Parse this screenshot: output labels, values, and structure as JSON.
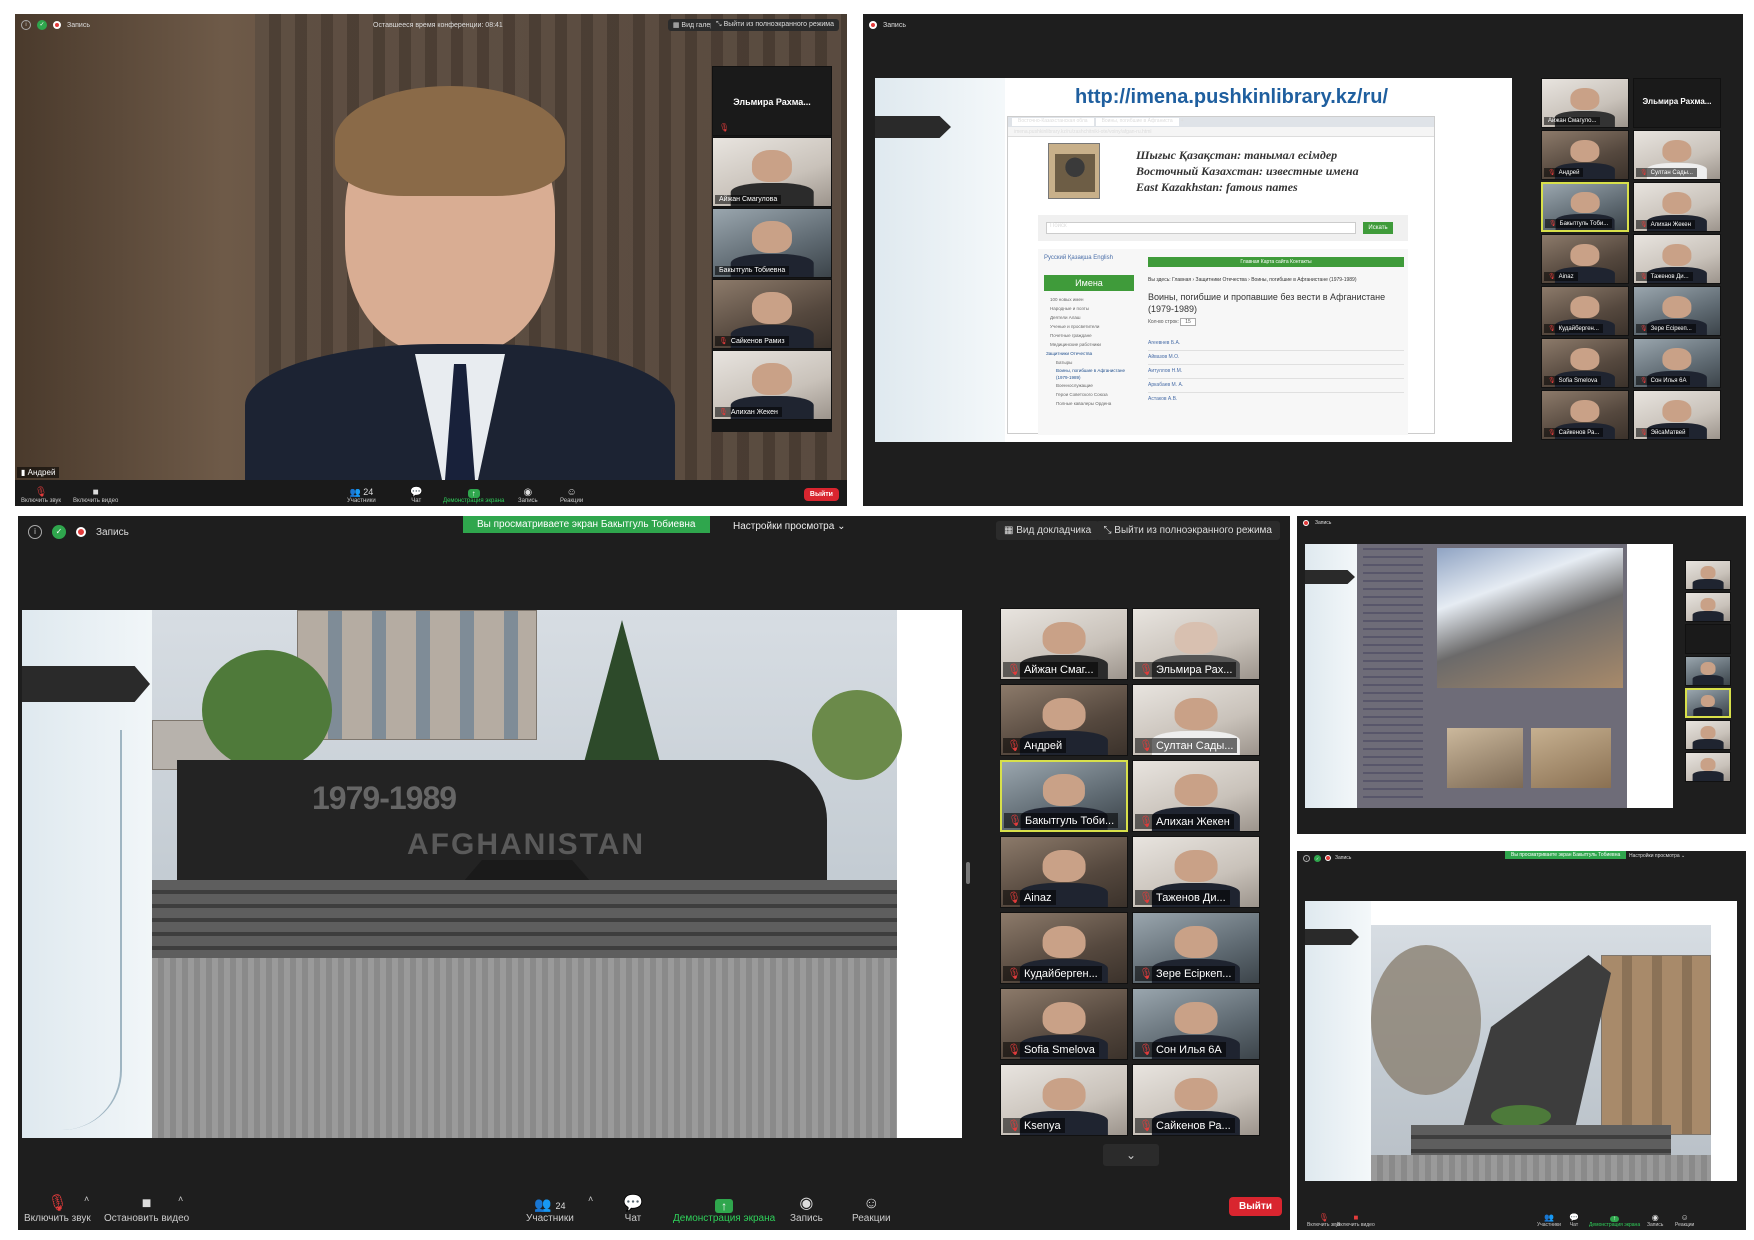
{
  "p1": {
    "topbar": {
      "record": "Запись",
      "timer": "Оставшееся время конференции: 08:41",
      "gallery": "Вид галереи",
      "exit_fullscreen": "Выйти из полноэкранного режима"
    },
    "speaker": "Андрей",
    "participants": [
      {
        "name": "Эльмира Рахма..."
      },
      {
        "name": "Айжан Смагулова"
      },
      {
        "name": "Бакытгуль Тобиевна"
      },
      {
        "name": "Сайкенов Рамиз"
      },
      {
        "name": "Алихан Жекен"
      }
    ],
    "toolbar": {
      "mute": "Включить звук",
      "video": "Включить видео",
      "participants": "Участники",
      "count": "24",
      "chat": "Чат",
      "share": "Демонстрация экрана",
      "record": "Запись",
      "reactions": "Реакции",
      "leave": "Выйти"
    }
  },
  "p2": {
    "topbar": {
      "record": "Запись"
    },
    "slide": {
      "url_heading": "http://imena.pushkinlibrary.kz/ru/",
      "tabs": [
        "Восточно-Казахстанская обла",
        "Воины, погибшие в Афганиста"
      ],
      "address": "imena.pushkinlibrary.kz/ru/zashchitniki-ote/voiny/afgan-ru.html",
      "titles": [
        "Шығыс Қазақстан: танымал есімдер",
        "Восточный Казахстан: известные имена",
        "East Kazakhstan: famous names"
      ],
      "search_placeholder": "Поиск",
      "search_button": "Искать",
      "lang": "Русский  Қазақша  English",
      "nav": "Главная  Карта сайта  Контакты",
      "sidebar_title": "Имена",
      "sidebar": [
        "100 новых имен",
        "Народные и поэты",
        "Деятели Алаш",
        "Ученые и просветители",
        "Почетные граждане",
        "Медицинские работники",
        "Защитники Отечества",
        "Батыры",
        "Воины, погибшие в Афганистане (1979-1989)",
        "Военнослужащие",
        "Герои Советского Союза",
        "Полные кавалеры Ордена"
      ],
      "breadcrumb": "Вы здесь: Главная › Защитники Отечества › Воины, погибшие в Афганистане (1979-1989)",
      "page_title": "Воины, погибшие и пропавшие без вести в Афганистане (1979-1989)",
      "per_page_label": "Кол-во строк:",
      "per_page_value": "15",
      "names": [
        "Агеевнев Б.А.",
        "Айвазов М.О.",
        "Аитуллов Н.М.",
        "Аркабаев М. А.",
        "Астаков А.В."
      ]
    },
    "participants": [
      {
        "name": "Айжан Смагуло..."
      },
      {
        "name": "Эльмира Рахма..."
      },
      {
        "name": "Андрей"
      },
      {
        "name": "Султан Сады..."
      },
      {
        "name": "Бакытгуль Тоби..."
      },
      {
        "name": "Алихан Жекен"
      },
      {
        "name": "Ainaz"
      },
      {
        "name": "Таженов Ди..."
      },
      {
        "name": "Кудайберген..."
      },
      {
        "name": "Зере Есіркеп..."
      },
      {
        "name": "Sofia Smelova"
      },
      {
        "name": "Сон Илья 6А"
      },
      {
        "name": "Сайкенов Ра..."
      },
      {
        "name": "ЭйсаМатвей"
      }
    ]
  },
  "p3": {
    "topbar": {
      "record": "Запись",
      "viewing": "Вы просматриваете экран Бакытгуль Тобиевна",
      "view_settings": "Настройки просмотра",
      "speaker_view": "Вид докладчика",
      "exit_fullscreen": "Выйти из полноэкранного режима"
    },
    "participants": [
      {
        "name": "Айжан Смаг..."
      },
      {
        "name": "Эльмира Рах..."
      },
      {
        "name": "Андрей"
      },
      {
        "name": "Султан Сады..."
      },
      {
        "name": "Бакытгуль Тоби..."
      },
      {
        "name": "Алихан Жекен"
      },
      {
        "name": "Ainaz"
      },
      {
        "name": "Таженов Ди..."
      },
      {
        "name": "Кудайберген..."
      },
      {
        "name": "Зере Есіркеп..."
      },
      {
        "name": "Sofia Smelova"
      },
      {
        "name": "Сон Илья 6А"
      },
      {
        "name": "Ksenya"
      },
      {
        "name": "Сайкенов Ра..."
      }
    ],
    "memorial": {
      "years": "1979-1989",
      "word": "AFGHANISTAN"
    },
    "toolbar": {
      "mute": "Включить звук",
      "video": "Остановить видео",
      "participants": "Участники",
      "count": "24",
      "chat": "Чат",
      "share": "Демонстрация экрана",
      "record": "Запись",
      "reactions": "Реакции",
      "leave": "Выйти"
    }
  },
  "p4": {
    "topbar": {
      "record": "Запись"
    }
  },
  "p5": {
    "topbar": {
      "record": "Запись",
      "viewing": "Вы просматриваете экран Бакытгуль Тобиевна",
      "view_settings": "Настройки просмотра"
    },
    "toolbar": {
      "mute": "Включить звук",
      "video": "Включить видео",
      "participants": "Участники",
      "chat": "Чат",
      "share": "Демонстрация экрана",
      "record": "Запись",
      "reactions": "Реакции"
    }
  }
}
